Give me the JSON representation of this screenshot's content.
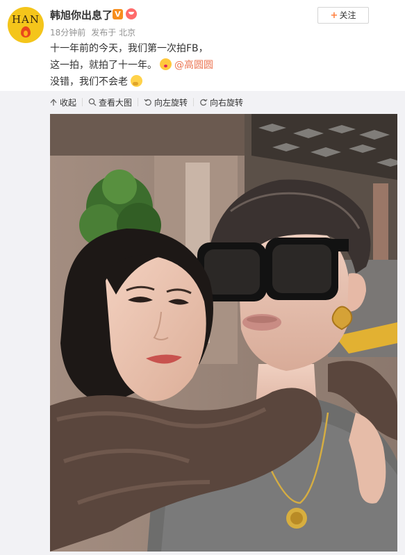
{
  "post": {
    "username": "韩旭你出息了",
    "verified_badge": "V",
    "avatar_text": "HAN",
    "time": "18分钟前",
    "source": "发布于 北京",
    "follow_label": "关注",
    "lines": [
      "十一年前的今天，我们第一次拍FB，",
      "这一拍，就拍了十一年。",
      "没错，我们不会老"
    ],
    "mention": "@高圆圆"
  },
  "toolbar": {
    "collapse": "收起",
    "view_large": "查看大图",
    "rotate_left": "向左旋转",
    "rotate_right": "向右旋转"
  },
  "icons": [
    "collapse-icon",
    "search-icon",
    "rotate-left-icon",
    "rotate-right-icon",
    "plus-icon"
  ],
  "colors": {
    "accent": "#ff8140",
    "mention": "#eb7350",
    "meta": "#939393",
    "verified": "#f78e1e"
  }
}
